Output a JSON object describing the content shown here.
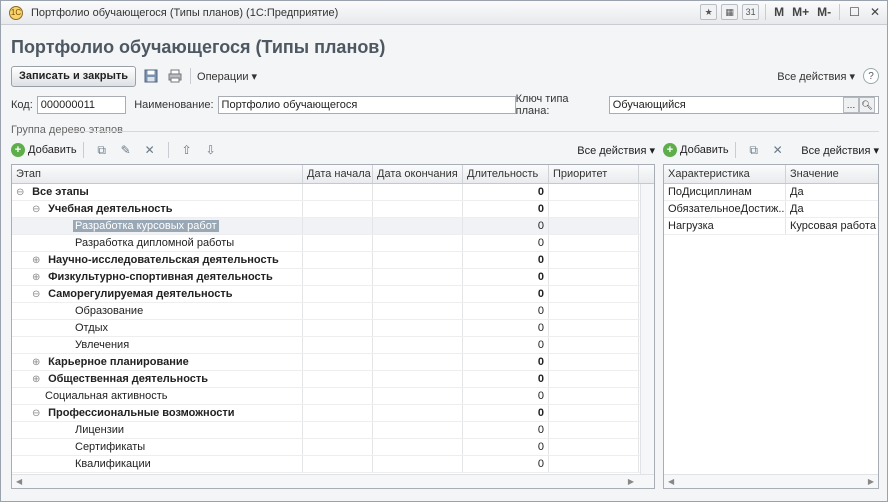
{
  "window": {
    "title": "Портфолио обучающегося (Типы планов) (1С:Предприятие)",
    "memory_buttons": [
      "M",
      "M+",
      "M-"
    ]
  },
  "form": {
    "title": "Портфолио обучающегося (Типы планов)"
  },
  "toolbar": {
    "save_close": "Записать и закрыть",
    "operations": "Операции ▾",
    "all_actions": "Все действия ▾",
    "help": "?"
  },
  "fields": {
    "code_label": "Код:",
    "code_value": "000000011",
    "name_label": "Наименование:",
    "name_value": "Портфолио обучающегося",
    "key_label": "Ключ типа плана:",
    "key_value": "Обучающийся"
  },
  "group": {
    "caption": "Группа дерево этапов"
  },
  "stages_toolbar": {
    "add": "Добавить",
    "all_actions": "Все действия ▾"
  },
  "stages_table": {
    "headers": [
      "Этап",
      "Дата начала",
      "Дата окончания",
      "Длительность",
      "Приоритет"
    ],
    "rows": [
      {
        "name": "Все этапы",
        "level": 0,
        "bold": true,
        "toggle": "⊖",
        "duration": "0"
      },
      {
        "name": "Учебная деятельность",
        "level": 1,
        "bold": true,
        "toggle": "⊖",
        "duration": "0"
      },
      {
        "name": "Разработка курсовых работ",
        "level": 2,
        "bold": false,
        "toggle": "",
        "duration": "0",
        "selected": true
      },
      {
        "name": "Разработка дипломной работы",
        "level": 2,
        "bold": false,
        "toggle": "",
        "duration": "0"
      },
      {
        "name": "Научно-исследовательская деятельность",
        "level": 1,
        "bold": true,
        "toggle": "⊕",
        "duration": "0"
      },
      {
        "name": "Физкультурно-спортивная деятельность",
        "level": 1,
        "bold": true,
        "toggle": "⊕",
        "duration": "0"
      },
      {
        "name": "Саморегулируемая деятельность",
        "level": 1,
        "bold": true,
        "toggle": "⊖",
        "duration": "0"
      },
      {
        "name": "Образование",
        "level": 2,
        "bold": false,
        "toggle": "",
        "duration": "0"
      },
      {
        "name": "Отдых",
        "level": 2,
        "bold": false,
        "toggle": "",
        "duration": "0"
      },
      {
        "name": "Увлечения",
        "level": 2,
        "bold": false,
        "toggle": "",
        "duration": "0"
      },
      {
        "name": "Карьерное планирование",
        "level": 1,
        "bold": true,
        "toggle": "⊕",
        "duration": "0"
      },
      {
        "name": "Общественная деятельность",
        "level": 1,
        "bold": true,
        "toggle": "⊕",
        "duration": "0"
      },
      {
        "name": "Социальная активность",
        "level": 1,
        "bold": false,
        "toggle": "",
        "duration": "0"
      },
      {
        "name": "Профессиональные возможности",
        "level": 1,
        "bold": true,
        "toggle": "⊖",
        "duration": "0"
      },
      {
        "name": "Лицензии",
        "level": 2,
        "bold": false,
        "toggle": "",
        "duration": "0"
      },
      {
        "name": "Сертификаты",
        "level": 2,
        "bold": false,
        "toggle": "",
        "duration": "0"
      },
      {
        "name": "Квалификации",
        "level": 2,
        "bold": false,
        "toggle": "",
        "duration": "0"
      }
    ]
  },
  "props_toolbar": {
    "add": "Добавить",
    "all_actions": "Все действия ▾"
  },
  "props_table": {
    "headers": [
      "Характеристика",
      "Значение"
    ],
    "rows": [
      {
        "key": "ПоДисциплинам",
        "value": "Да"
      },
      {
        "key": "ОбязательноеДостиж...",
        "value": "Да"
      },
      {
        "key": "Нагрузка",
        "value": "Курсовая работа"
      }
    ]
  }
}
